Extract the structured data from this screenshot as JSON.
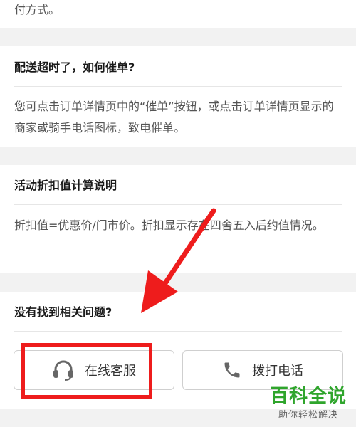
{
  "prev_answer": {
    "tail": "付方式。"
  },
  "faq": [
    {
      "question": "配送超时了，如何催单?",
      "answer": "您可点击订单详情页中的“催单”按钮，或点击订单详情页显示的商家或骑手电话图标，致电催单。"
    },
    {
      "question": "活动折扣值计算说明",
      "answer": "折扣值=优惠价/门市价。折扣显示存在四舍五入后约值情况。"
    }
  ],
  "help": {
    "title": "没有找到相关问题?",
    "online_service_label": "在线客服",
    "online_service_icon": "headset-icon",
    "call_label": "拨打电话",
    "call_icon": "phone-icon"
  },
  "watermark": {
    "main": "百科全说",
    "sub": "助你轻松解决"
  },
  "annotation": {
    "color": "#ee1c1c"
  }
}
